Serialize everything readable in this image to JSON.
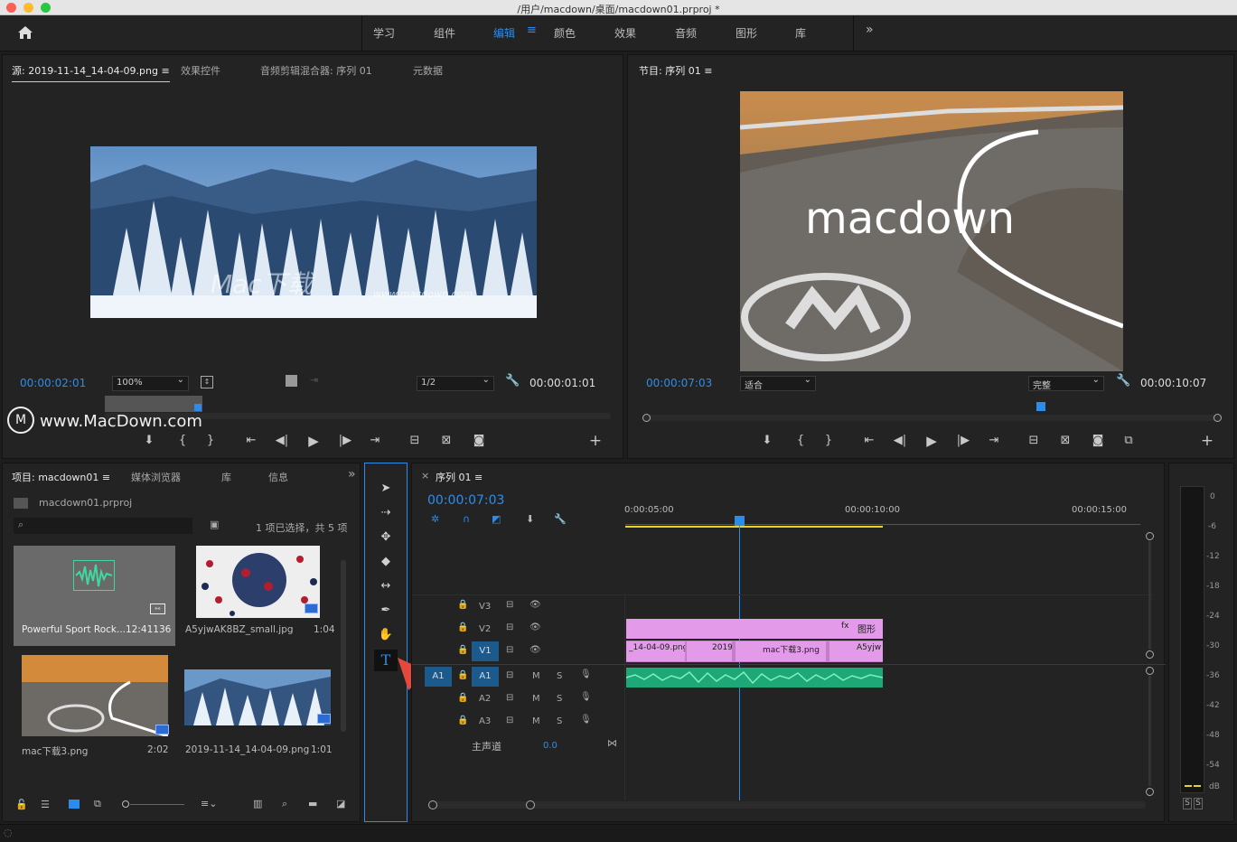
{
  "window": {
    "title": "/用户/macdown/桌面/macdown01.prproj *"
  },
  "workspaces": [
    {
      "label": "学习",
      "active": false
    },
    {
      "label": "组件",
      "active": false
    },
    {
      "label": "编辑",
      "active": true
    },
    {
      "label": "颜色",
      "active": false
    },
    {
      "label": "效果",
      "active": false
    },
    {
      "label": "音频",
      "active": false
    },
    {
      "label": "图形",
      "active": false
    },
    {
      "label": "库",
      "active": false
    }
  ],
  "source_panel": {
    "tabs": [
      "源: 2019-11-14_14-04-09.png",
      "效果控件",
      "音频剪辑混合器: 序列 01",
      "元数据"
    ],
    "timecode_in": "00:00:02:01",
    "zoom": "100%",
    "resolution": "1/2",
    "duration": "00:00:01:01",
    "watermark_text": "Mac下载",
    "watermark_url": "www.macdown.com"
  },
  "program_panel": {
    "tab": "节目: 序列 01",
    "timecode_in": "00:00:07:03",
    "fit": "适合",
    "quality": "完整",
    "duration": "00:00:10:07",
    "overlay_text": "macdown"
  },
  "site_watermark": "www.MacDown.com",
  "project_panel": {
    "tabs": [
      "项目: macdown01",
      "媒体浏览器",
      "库",
      "信息"
    ],
    "file": "macdown01.prproj",
    "selection_info": "1 项已选择，共 5 项",
    "items": [
      {
        "name": "Powerful Sport Rock...",
        "duration": "12:41136"
      },
      {
        "name": "A5yjwAK8BZ_small.jpg",
        "duration": "1:04"
      },
      {
        "name": "mac下载3.png",
        "duration": "2:02"
      },
      {
        "name": "2019-11-14_14-04-09.png",
        "duration": "1:01"
      }
    ]
  },
  "timeline": {
    "tab": "序列 01",
    "timecode": "00:00:07:03",
    "ruler": [
      "0:00:05:00",
      "00:00:10:00",
      "00:00:15:00"
    ],
    "video_tracks": [
      "V3",
      "V2",
      "V1"
    ],
    "audio_tracks": [
      "A1",
      "A2",
      "A3"
    ],
    "source_patch_audio": "A1",
    "source_patch_video": "V1",
    "master_label": "主声道",
    "master_value": "0.0",
    "mute_label": "M",
    "solo_label": "S",
    "clips_v2": [
      {
        "label": "图形"
      }
    ],
    "clips_v1": [
      {
        "label": "_14-04-09.png"
      },
      {
        "label": "2019"
      },
      {
        "label": "mac下载3.png"
      },
      {
        "label": "A5yjw"
      }
    ]
  },
  "meter": {
    "scale": [
      "0",
      "-6",
      "-12",
      "-18",
      "-24",
      "-30",
      "-36",
      "-42",
      "-48",
      "-54",
      "dB"
    ],
    "solo": [
      "S",
      "S"
    ]
  },
  "colors": {
    "accent": "#2d8ceb",
    "clip_pink": "#e39ae8",
    "audio_green": "#21c08b"
  }
}
